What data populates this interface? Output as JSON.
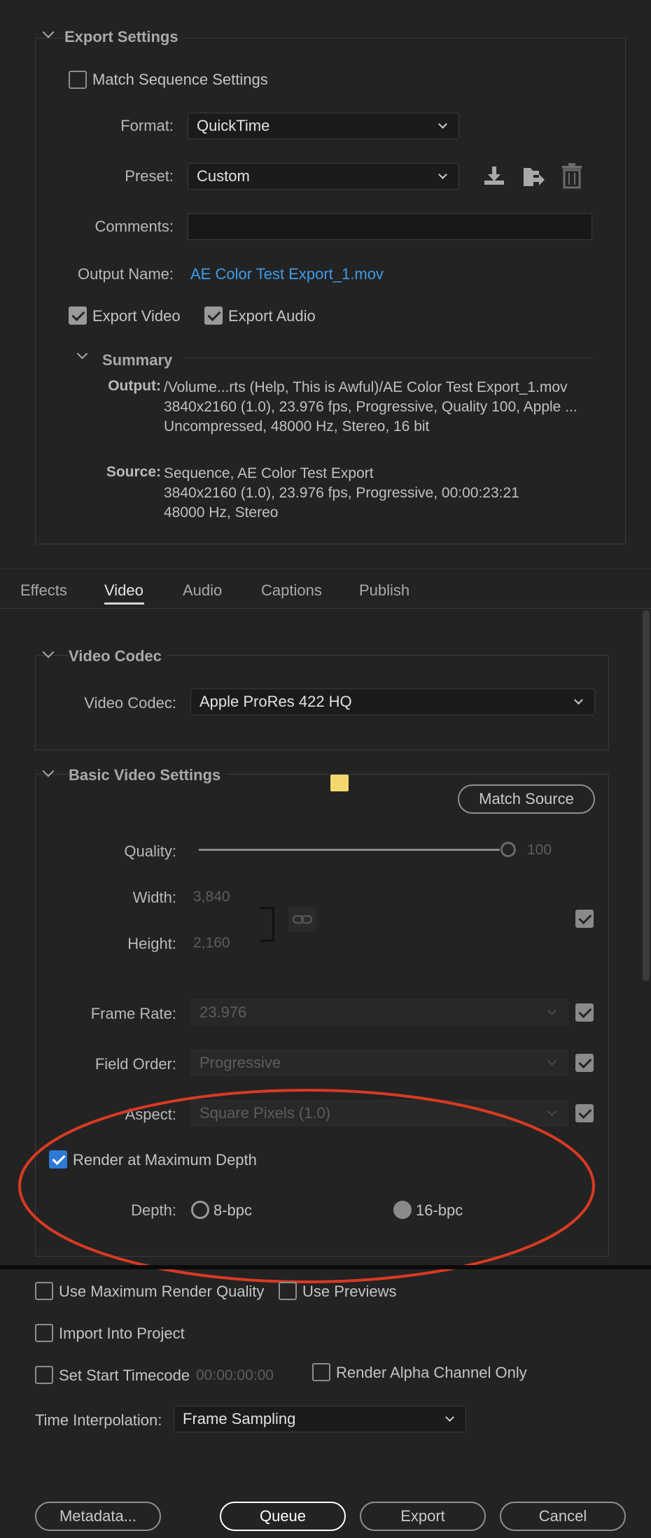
{
  "export_settings": {
    "title": "Export Settings",
    "match_sequence_label": "Match Sequence Settings",
    "format_label": "Format:",
    "format_value": "QuickTime",
    "preset_label": "Preset:",
    "preset_value": "Custom",
    "comments_label": "Comments:",
    "comments_value": "",
    "output_name_label": "Output Name:",
    "output_name_value": "AE Color Test Export_1.mov",
    "export_video_label": "Export Video",
    "export_audio_label": "Export Audio",
    "summary": {
      "title": "Summary",
      "output_key": "Output:",
      "output_lines": [
        "/Volume...rts (Help, This is Awful)/AE Color Test Export_1.mov",
        "3840x2160 (1.0), 23.976 fps, Progressive, Quality 100, Apple ...",
        "Uncompressed, 48000 Hz, Stereo, 16 bit"
      ],
      "source_key": "Source:",
      "source_lines": [
        "Sequence, AE Color Test Export",
        "3840x2160 (1.0), 23.976 fps, Progressive, 00:00:23:21",
        "48000 Hz, Stereo"
      ]
    }
  },
  "tabs": [
    "Effects",
    "Video",
    "Audio",
    "Captions",
    "Publish"
  ],
  "active_tab": "Video",
  "video_codec": {
    "title": "Video Codec",
    "label": "Video Codec:",
    "value": "Apple ProRes 422 HQ"
  },
  "basic_video": {
    "title": "Basic Video Settings",
    "match_source_label": "Match Source",
    "quality_label": "Quality:",
    "quality_value": "100",
    "quality_fraction": 1.0,
    "width_label": "Width:",
    "width_value": "3,840",
    "height_label": "Height:",
    "height_value": "2,160",
    "frame_rate_label": "Frame Rate:",
    "frame_rate_value": "23.976",
    "field_order_label": "Field Order:",
    "field_order_value": "Progressive",
    "aspect_label": "Aspect:",
    "aspect_value": "Square Pixels (1.0)",
    "render_max_depth_label": "Render at Maximum Depth",
    "depth_label": "Depth:",
    "depth_8_label": "8-bpc",
    "depth_16_label": "16-bpc",
    "depth_selected": "16-bpc"
  },
  "bottom": {
    "use_max_render_label": "Use Maximum Render Quality",
    "use_previews_label": "Use Previews",
    "import_label": "Import Into Project",
    "set_start_tc_label": "Set Start Timecode",
    "start_tc_value": "00:00:00:00",
    "render_alpha_label": "Render Alpha Channel Only",
    "time_interp_label": "Time Interpolation:",
    "time_interp_value": "Frame Sampling"
  },
  "buttons": {
    "metadata": "Metadata...",
    "queue": "Queue",
    "export": "Export",
    "cancel": "Cancel"
  },
  "colors": {
    "background": "#232323",
    "link": "#3d9be9",
    "highlight_ellipse": "#d93a22",
    "checkbox_blue": "#2d7ad6",
    "marker_yellow": "#f5d76e"
  },
  "icons": [
    "chevron-down-icon",
    "save-preset-icon",
    "import-preset-icon",
    "trash-icon",
    "link-icon"
  ]
}
